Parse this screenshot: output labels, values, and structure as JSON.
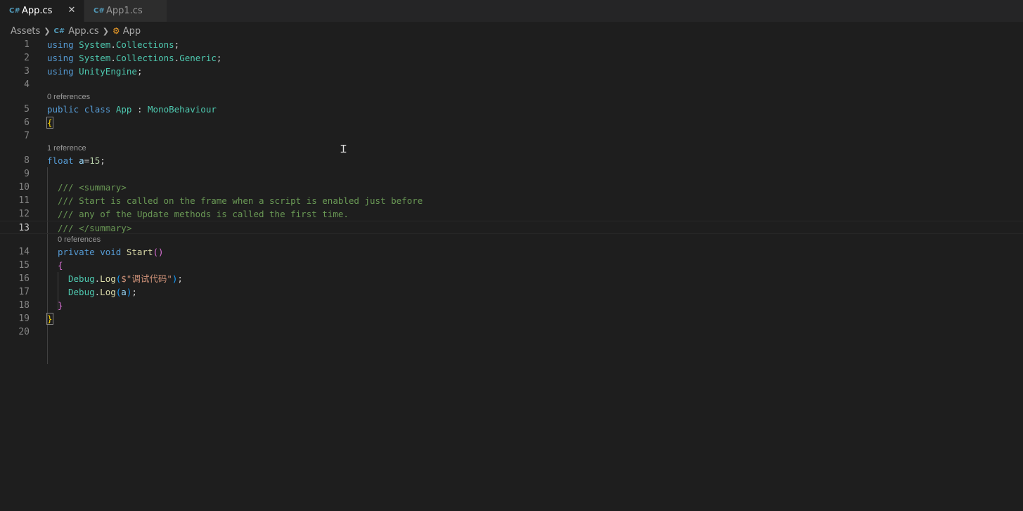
{
  "tabs": [
    {
      "label": "App.cs",
      "icon": "csharp-icon",
      "active": true,
      "close": "✕"
    },
    {
      "label": "App1.cs",
      "icon": "csharp-icon",
      "active": false
    }
  ],
  "breadcrumb": {
    "items": [
      {
        "label": "Assets"
      },
      {
        "label": "App.cs",
        "icon": "csharp-icon"
      },
      {
        "label": "App",
        "icon": "class-icon"
      }
    ]
  },
  "editor": {
    "current_line": 13,
    "lines": [
      {
        "n": "1"
      },
      {
        "n": "2"
      },
      {
        "n": "3"
      },
      {
        "n": "4"
      },
      {
        "n": "5",
        "lens": "0 references"
      },
      {
        "n": "6"
      },
      {
        "n": "7"
      },
      {
        "n": "8",
        "lens": "1 reference"
      },
      {
        "n": "9"
      },
      {
        "n": "10"
      },
      {
        "n": "11"
      },
      {
        "n": "12"
      },
      {
        "n": "13"
      },
      {
        "n": "14",
        "lens": "0 references"
      },
      {
        "n": "15"
      },
      {
        "n": "16"
      },
      {
        "n": "17"
      },
      {
        "n": "18"
      },
      {
        "n": "19"
      },
      {
        "n": "20"
      }
    ],
    "code": {
      "l1": {
        "kw": "using",
        "ns1": "System",
        "ns2": "Collections"
      },
      "l2": {
        "kw": "using",
        "ns1": "System",
        "ns2": "Collections",
        "ns3": "Generic"
      },
      "l3": {
        "kw": "using",
        "ns1": "UnityEngine"
      },
      "l5": {
        "kw1": "public",
        "kw2": "class",
        "name": "App",
        "colon": ":",
        "base": "MonoBehaviour"
      },
      "l6": {
        "brace": "{"
      },
      "l8": {
        "type": "float",
        "var": "a",
        "eq": "=",
        "num": "15",
        "semi": ";"
      },
      "l10": {
        "comment": "/// <summary>"
      },
      "l11": {
        "comment": "/// Start is called on the frame when a script is enabled just before"
      },
      "l12": {
        "comment": "/// any of the Update methods is called the first time."
      },
      "l13": {
        "comment": "/// </summary>"
      },
      "l14": {
        "kw1": "private",
        "kw2": "void",
        "fn": "Start",
        "parens": "()"
      },
      "l15": {
        "brace": "{"
      },
      "l16": {
        "cls": "Debug",
        "fn": "Log",
        "str": "$\"调试代码\""
      },
      "l17": {
        "cls": "Debug",
        "fn": "Log",
        "var": "a"
      },
      "l18": {
        "brace": "}"
      },
      "l19": {
        "brace": "}"
      }
    }
  },
  "colors": {
    "background": "#1e1e1e",
    "keyword": "#569cd6",
    "type": "#4ec9b0",
    "function": "#dcdcaa",
    "comment": "#6a9955",
    "string": "#ce9178",
    "number": "#b5cea8"
  }
}
